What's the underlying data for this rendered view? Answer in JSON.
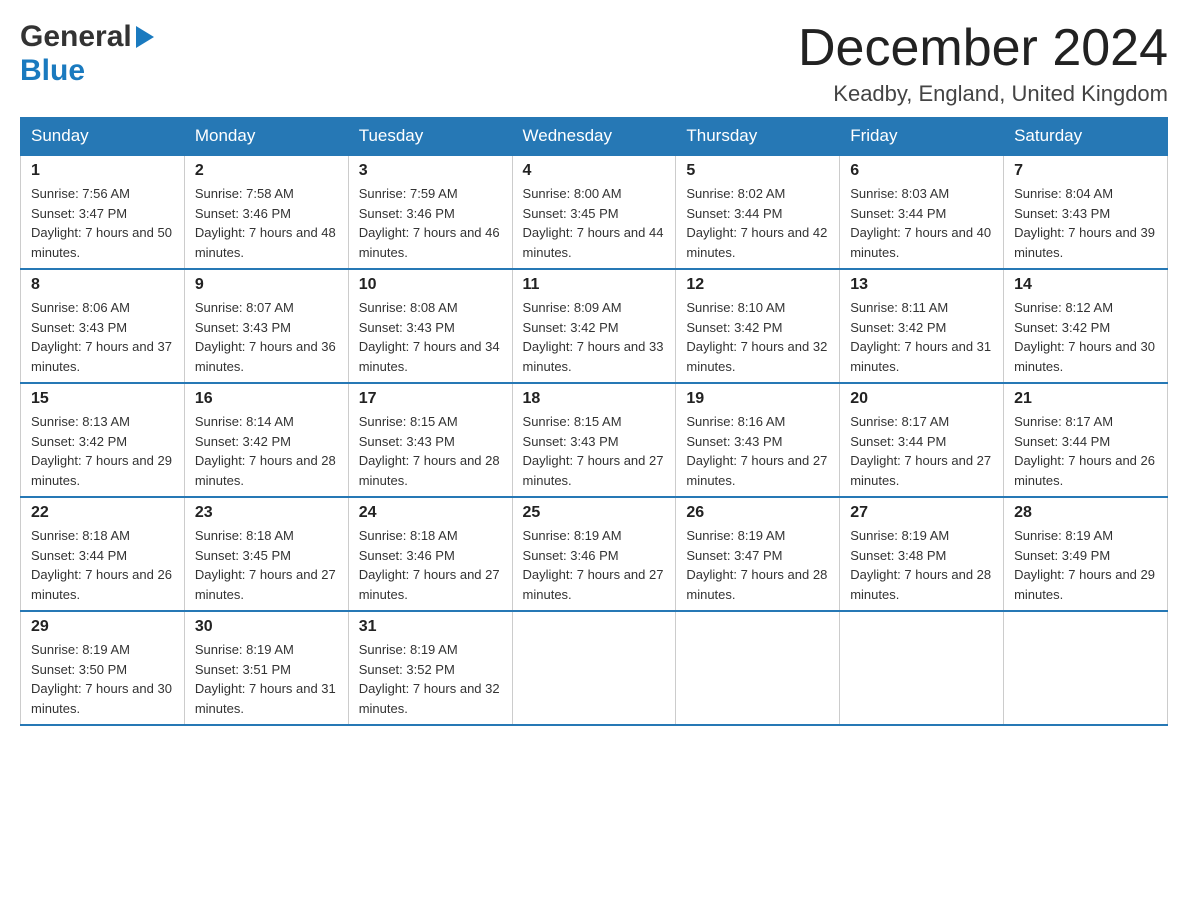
{
  "header": {
    "logo_general": "General",
    "logo_blue": "Blue",
    "title": "December 2024",
    "location": "Keadby, England, United Kingdom"
  },
  "days_of_week": [
    "Sunday",
    "Monday",
    "Tuesday",
    "Wednesday",
    "Thursday",
    "Friday",
    "Saturday"
  ],
  "weeks": [
    [
      {
        "day": "1",
        "sunrise": "Sunrise: 7:56 AM",
        "sunset": "Sunset: 3:47 PM",
        "daylight": "Daylight: 7 hours and 50 minutes."
      },
      {
        "day": "2",
        "sunrise": "Sunrise: 7:58 AM",
        "sunset": "Sunset: 3:46 PM",
        "daylight": "Daylight: 7 hours and 48 minutes."
      },
      {
        "day": "3",
        "sunrise": "Sunrise: 7:59 AM",
        "sunset": "Sunset: 3:46 PM",
        "daylight": "Daylight: 7 hours and 46 minutes."
      },
      {
        "day": "4",
        "sunrise": "Sunrise: 8:00 AM",
        "sunset": "Sunset: 3:45 PM",
        "daylight": "Daylight: 7 hours and 44 minutes."
      },
      {
        "day": "5",
        "sunrise": "Sunrise: 8:02 AM",
        "sunset": "Sunset: 3:44 PM",
        "daylight": "Daylight: 7 hours and 42 minutes."
      },
      {
        "day": "6",
        "sunrise": "Sunrise: 8:03 AM",
        "sunset": "Sunset: 3:44 PM",
        "daylight": "Daylight: 7 hours and 40 minutes."
      },
      {
        "day": "7",
        "sunrise": "Sunrise: 8:04 AM",
        "sunset": "Sunset: 3:43 PM",
        "daylight": "Daylight: 7 hours and 39 minutes."
      }
    ],
    [
      {
        "day": "8",
        "sunrise": "Sunrise: 8:06 AM",
        "sunset": "Sunset: 3:43 PM",
        "daylight": "Daylight: 7 hours and 37 minutes."
      },
      {
        "day": "9",
        "sunrise": "Sunrise: 8:07 AM",
        "sunset": "Sunset: 3:43 PM",
        "daylight": "Daylight: 7 hours and 36 minutes."
      },
      {
        "day": "10",
        "sunrise": "Sunrise: 8:08 AM",
        "sunset": "Sunset: 3:43 PM",
        "daylight": "Daylight: 7 hours and 34 minutes."
      },
      {
        "day": "11",
        "sunrise": "Sunrise: 8:09 AM",
        "sunset": "Sunset: 3:42 PM",
        "daylight": "Daylight: 7 hours and 33 minutes."
      },
      {
        "day": "12",
        "sunrise": "Sunrise: 8:10 AM",
        "sunset": "Sunset: 3:42 PM",
        "daylight": "Daylight: 7 hours and 32 minutes."
      },
      {
        "day": "13",
        "sunrise": "Sunrise: 8:11 AM",
        "sunset": "Sunset: 3:42 PM",
        "daylight": "Daylight: 7 hours and 31 minutes."
      },
      {
        "day": "14",
        "sunrise": "Sunrise: 8:12 AM",
        "sunset": "Sunset: 3:42 PM",
        "daylight": "Daylight: 7 hours and 30 minutes."
      }
    ],
    [
      {
        "day": "15",
        "sunrise": "Sunrise: 8:13 AM",
        "sunset": "Sunset: 3:42 PM",
        "daylight": "Daylight: 7 hours and 29 minutes."
      },
      {
        "day": "16",
        "sunrise": "Sunrise: 8:14 AM",
        "sunset": "Sunset: 3:42 PM",
        "daylight": "Daylight: 7 hours and 28 minutes."
      },
      {
        "day": "17",
        "sunrise": "Sunrise: 8:15 AM",
        "sunset": "Sunset: 3:43 PM",
        "daylight": "Daylight: 7 hours and 28 minutes."
      },
      {
        "day": "18",
        "sunrise": "Sunrise: 8:15 AM",
        "sunset": "Sunset: 3:43 PM",
        "daylight": "Daylight: 7 hours and 27 minutes."
      },
      {
        "day": "19",
        "sunrise": "Sunrise: 8:16 AM",
        "sunset": "Sunset: 3:43 PM",
        "daylight": "Daylight: 7 hours and 27 minutes."
      },
      {
        "day": "20",
        "sunrise": "Sunrise: 8:17 AM",
        "sunset": "Sunset: 3:44 PM",
        "daylight": "Daylight: 7 hours and 27 minutes."
      },
      {
        "day": "21",
        "sunrise": "Sunrise: 8:17 AM",
        "sunset": "Sunset: 3:44 PM",
        "daylight": "Daylight: 7 hours and 26 minutes."
      }
    ],
    [
      {
        "day": "22",
        "sunrise": "Sunrise: 8:18 AM",
        "sunset": "Sunset: 3:44 PM",
        "daylight": "Daylight: 7 hours and 26 minutes."
      },
      {
        "day": "23",
        "sunrise": "Sunrise: 8:18 AM",
        "sunset": "Sunset: 3:45 PM",
        "daylight": "Daylight: 7 hours and 27 minutes."
      },
      {
        "day": "24",
        "sunrise": "Sunrise: 8:18 AM",
        "sunset": "Sunset: 3:46 PM",
        "daylight": "Daylight: 7 hours and 27 minutes."
      },
      {
        "day": "25",
        "sunrise": "Sunrise: 8:19 AM",
        "sunset": "Sunset: 3:46 PM",
        "daylight": "Daylight: 7 hours and 27 minutes."
      },
      {
        "day": "26",
        "sunrise": "Sunrise: 8:19 AM",
        "sunset": "Sunset: 3:47 PM",
        "daylight": "Daylight: 7 hours and 28 minutes."
      },
      {
        "day": "27",
        "sunrise": "Sunrise: 8:19 AM",
        "sunset": "Sunset: 3:48 PM",
        "daylight": "Daylight: 7 hours and 28 minutes."
      },
      {
        "day": "28",
        "sunrise": "Sunrise: 8:19 AM",
        "sunset": "Sunset: 3:49 PM",
        "daylight": "Daylight: 7 hours and 29 minutes."
      }
    ],
    [
      {
        "day": "29",
        "sunrise": "Sunrise: 8:19 AM",
        "sunset": "Sunset: 3:50 PM",
        "daylight": "Daylight: 7 hours and 30 minutes."
      },
      {
        "day": "30",
        "sunrise": "Sunrise: 8:19 AM",
        "sunset": "Sunset: 3:51 PM",
        "daylight": "Daylight: 7 hours and 31 minutes."
      },
      {
        "day": "31",
        "sunrise": "Sunrise: 8:19 AM",
        "sunset": "Sunset: 3:52 PM",
        "daylight": "Daylight: 7 hours and 32 minutes."
      },
      null,
      null,
      null,
      null
    ]
  ]
}
